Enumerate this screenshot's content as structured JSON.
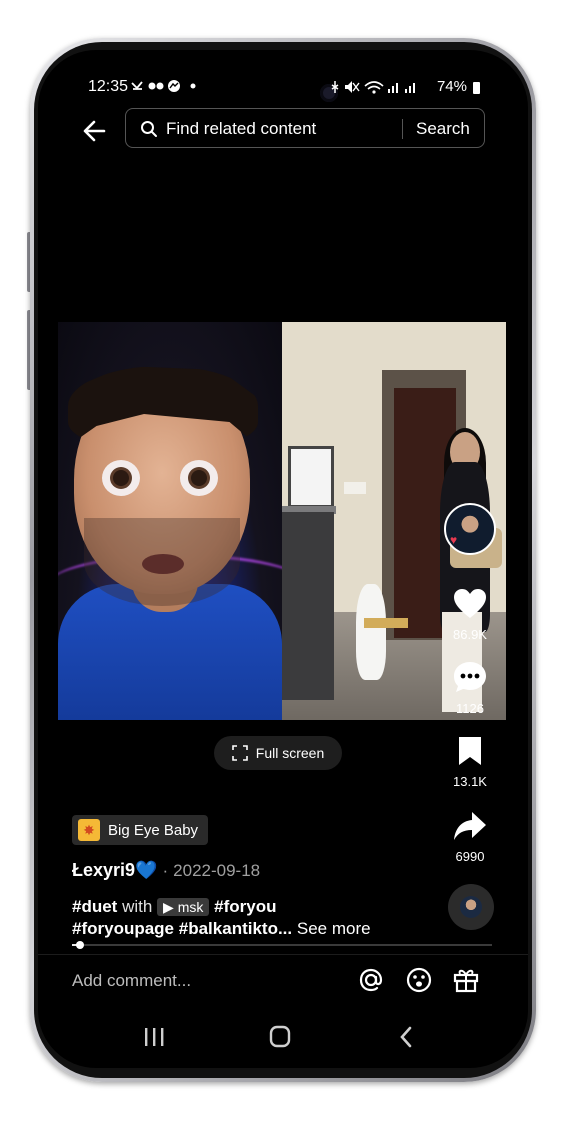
{
  "status_bar": {
    "time": "12:35",
    "left_icons": [
      "missed-call-icon",
      "voicemail-icon",
      "messenger-icon",
      "dot-icon"
    ],
    "battery": "74%"
  },
  "search": {
    "text": "Find related content",
    "button_label": "Search"
  },
  "actions": {
    "likes": "86.9K",
    "comments": "1126",
    "saves": "13.1K",
    "shares": "6990"
  },
  "fullscreen_label": "Full screen",
  "effect_label": "Big Eye Baby",
  "post": {
    "author": "Łexyri9💙",
    "separator": "·",
    "date": "2022-09-18",
    "caption_tag1": "#duet",
    "caption_with": "with",
    "duet_user": "msk",
    "caption_tag2": "#foryou",
    "caption_tag3": "#foryoupage",
    "caption_tag4": "#balkantikto...",
    "see_more": "See more"
  },
  "playback_progress": 0.02,
  "comment_placeholder": "Add comment...",
  "colors": {
    "background": "#000000",
    "like_heart": "#ffffff",
    "effect_icon": "#f5b936"
  }
}
